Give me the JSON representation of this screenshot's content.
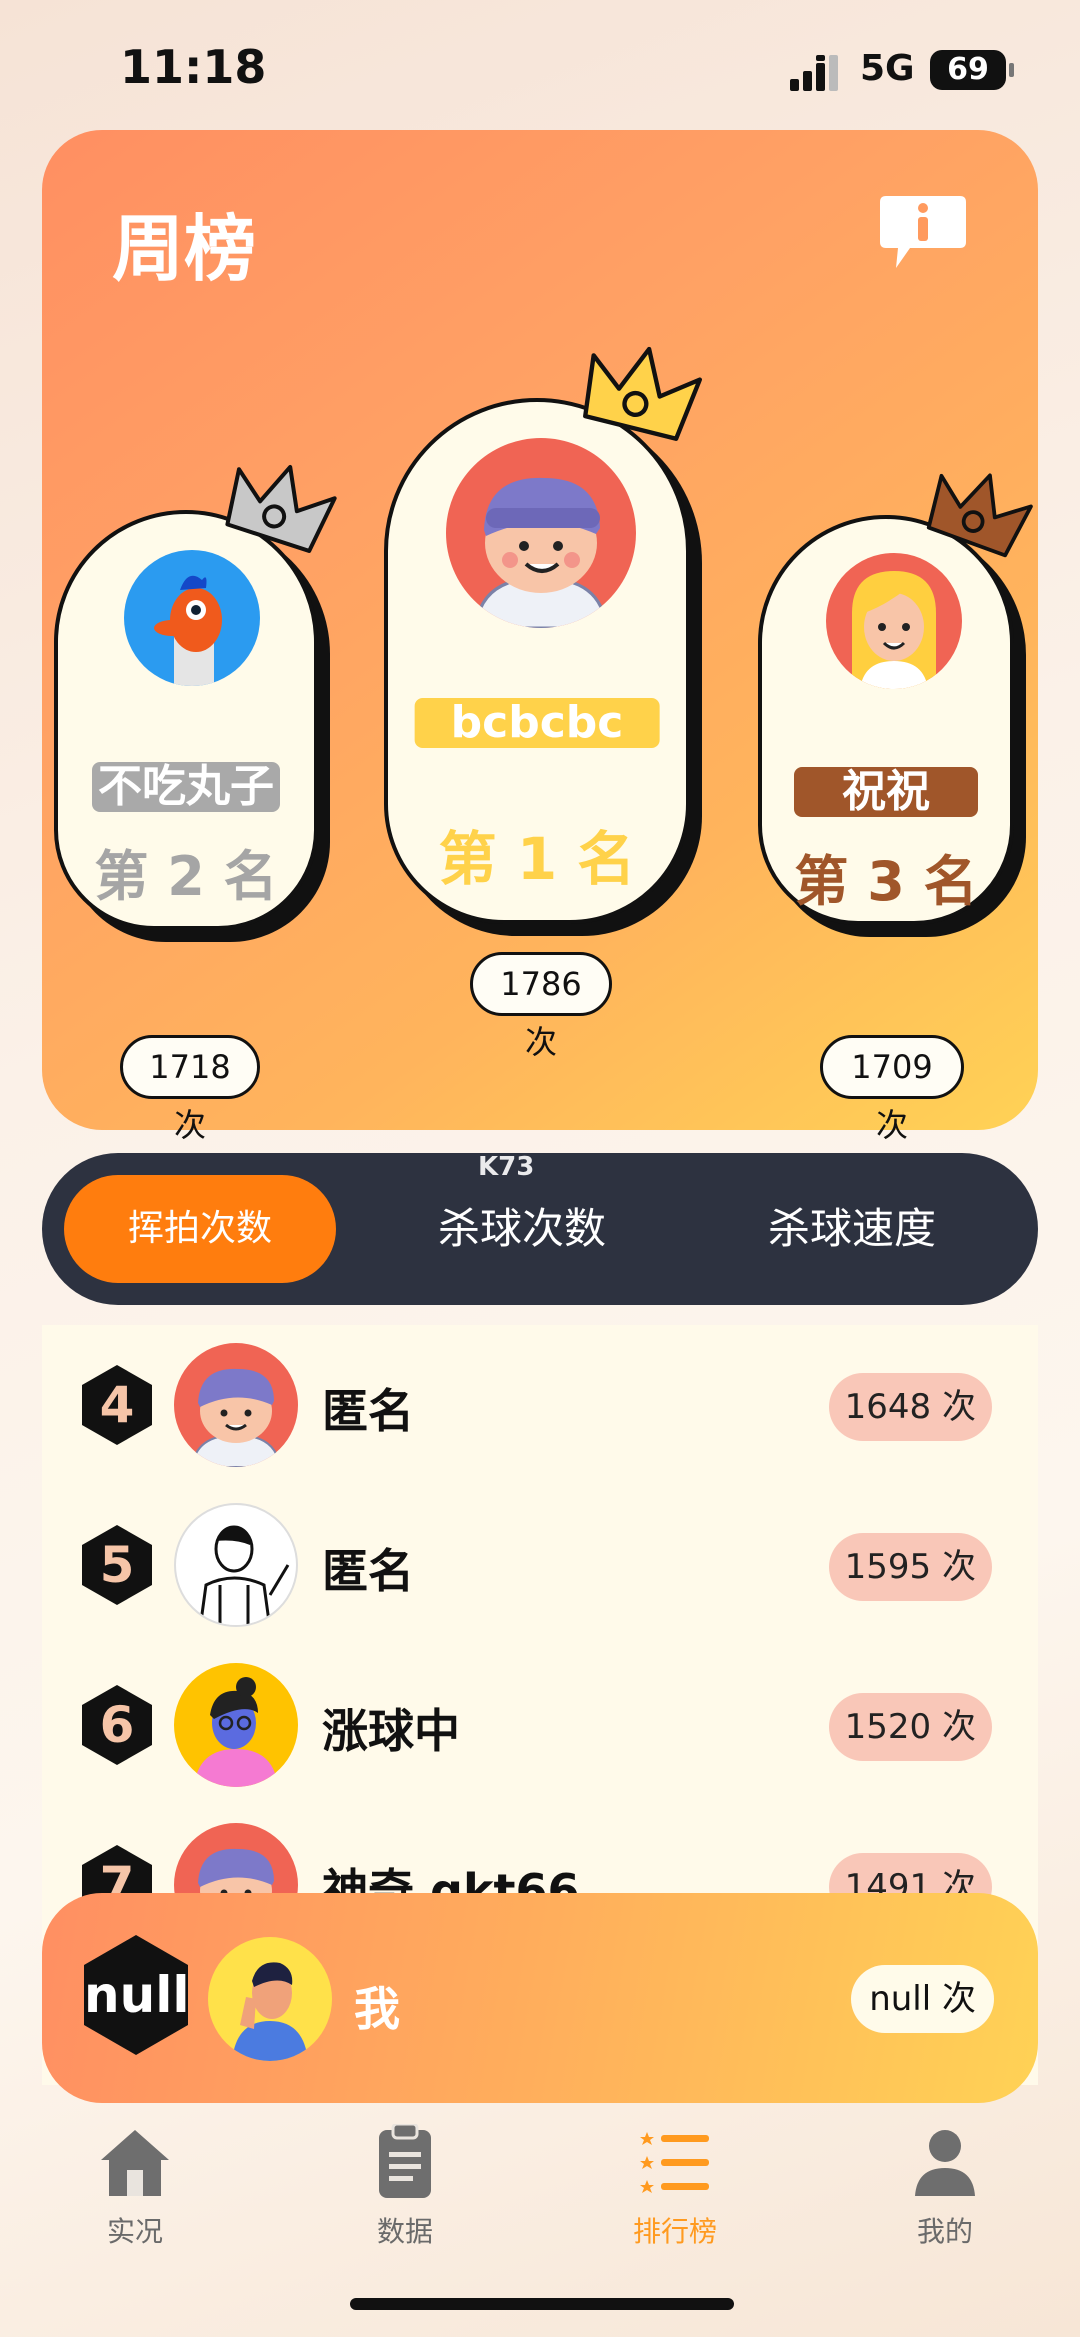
{
  "status_bar": {
    "time": "11:18",
    "network": "5G",
    "battery": "69"
  },
  "leaderboard": {
    "title": "周榜",
    "info_icon": "info-icon",
    "podium": [
      {
        "rank_label": "第 2 名",
        "name": "不吃丸子",
        "count": "1718 次",
        "crown_color": "#c8c8c8",
        "name_bg": "#a9a9a9",
        "rank_color": "#a5a5a5"
      },
      {
        "rank_label": "第 1 名",
        "name": "bcbcbc",
        "count": "1786 次",
        "crown_color": "#ffd24a",
        "name_bg": "#ffd24a",
        "rank_color": "#ffd24a"
      },
      {
        "rank_label": "第 3 名",
        "name": "祝祝",
        "count": "1709 次",
        "crown_color": "#a0562a",
        "name_bg": "#a0562a",
        "rank_color": "#a0562a"
      }
    ]
  },
  "tabs": [
    {
      "label": "挥拍次数",
      "active": true
    },
    {
      "label": "杀球次数",
      "active": false
    },
    {
      "label": "杀球速度",
      "active": false
    }
  ],
  "watermark": "K73",
  "rankings": [
    {
      "rank": "4",
      "name": "匿名",
      "count": "1648 次"
    },
    {
      "rank": "5",
      "name": "匿名",
      "count": "1595 次"
    },
    {
      "rank": "6",
      "name": "涨球中",
      "count": "1520 次"
    },
    {
      "rank": "7",
      "name": "神奇 qkt66",
      "count": "1491 次"
    }
  ],
  "me": {
    "rank": "null",
    "name": "我",
    "count": "null 次"
  },
  "bottom_nav": [
    {
      "label": "实况",
      "icon": "home-icon",
      "active": false
    },
    {
      "label": "数据",
      "icon": "clipboard-icon",
      "active": false
    },
    {
      "label": "排行榜",
      "icon": "ranking-list-icon",
      "active": true
    },
    {
      "label": "我的",
      "icon": "user-icon",
      "active": false
    }
  ],
  "colors": {
    "accent": "#ff7d0e",
    "tab_bar": "#2d3240",
    "count_pill": "#f9c7b8",
    "list_bg": "#fffaea"
  }
}
